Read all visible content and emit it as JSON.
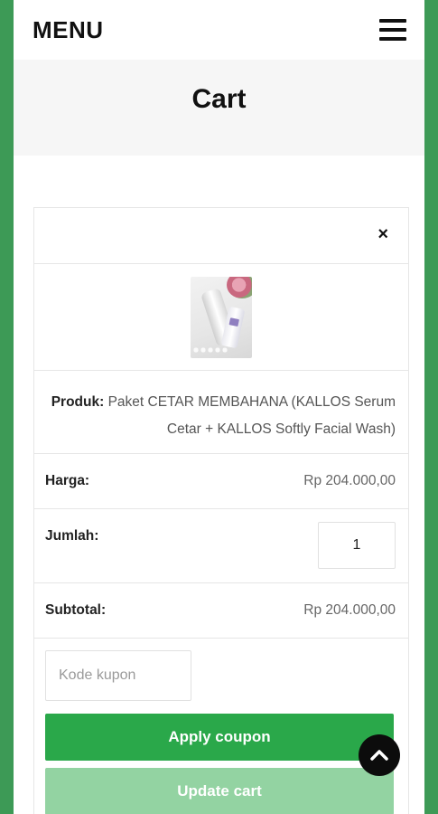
{
  "header": {
    "menu_label": "MENU"
  },
  "page": {
    "title": "Cart"
  },
  "cart_item": {
    "remove_symbol": "×",
    "product_label": "Produk:",
    "product_name": "Paket CETAR MEMBAHANA (KALLOS Serum Cetar + KALLOS Softly Facial Wash)",
    "price_label": "Harga:",
    "price_value": "Rp 204.000,00",
    "qty_label": "Jumlah:",
    "qty_value": "1",
    "subtotal_label": "Subtotal:",
    "subtotal_value": "Rp 204.000,00"
  },
  "coupon": {
    "placeholder": "Kode kupon",
    "apply_label": "Apply coupon",
    "update_label": "Update cart"
  },
  "icons": {
    "menu": "hamburger-icon",
    "remove": "close-icon",
    "scroll_top": "chevron-up-icon"
  },
  "colors": {
    "side_border": "#3d9a56",
    "apply_button": "#2aa84a",
    "update_button": "#93d3a2"
  }
}
